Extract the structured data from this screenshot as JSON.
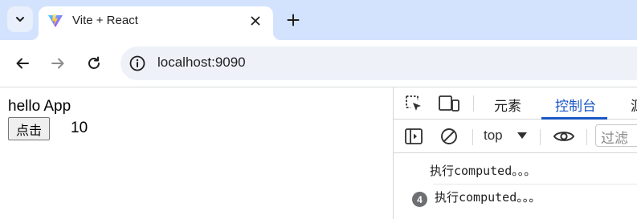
{
  "browser": {
    "tab": {
      "title": "Vite + React"
    },
    "address_bar": {
      "url": "localhost:9090"
    }
  },
  "page": {
    "heading": "hello App",
    "button_label": "点击",
    "counter_value": "10"
  },
  "devtools": {
    "tabs": [
      {
        "label": "元素",
        "active": false
      },
      {
        "label": "控制台",
        "active": true
      },
      {
        "label": "源",
        "active": false
      }
    ],
    "console": {
      "context": "top",
      "filter_placeholder": "过滤",
      "logs": [
        {
          "text": "执行computed。。。",
          "count": null
        },
        {
          "text": "执行computed。。。",
          "count": "4"
        }
      ]
    }
  },
  "colors": {
    "tab_strip": "#d3e3fd",
    "devtools_accent": "#1a56c4",
    "badge": "#6d6f73"
  }
}
